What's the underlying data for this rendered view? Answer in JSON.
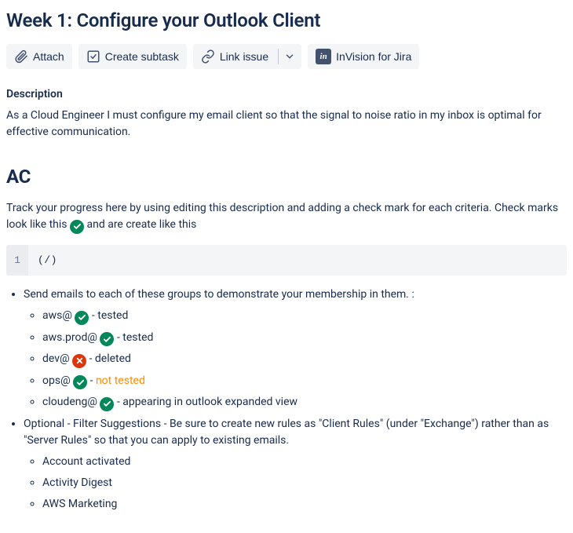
{
  "title": "Week 1: Configure your Outlook Client",
  "toolbar": {
    "attach": "Attach",
    "create_subtask": "Create subtask",
    "link_issue": "Link issue",
    "invision": "InVision for Jira"
  },
  "description": {
    "label": "Description",
    "text": "As a Cloud Engineer I must configure my email client so that the signal to noise ratio in my inbox is optimal for effective communication."
  },
  "ac": {
    "heading": "AC",
    "intro_pre": "Track your progress here by using editing this description and adding a check mark for each criteria. Check marks look like this ",
    "intro_post": " and are create like this",
    "code_line_no": "1",
    "code_text": "(/)",
    "items": {
      "send_header": "Send emails to each of these groups to demonstrate your membership in them. :",
      "aws_prefix": "aws@ ",
      "aws_status": " - tested",
      "awsprod_prefix": "aws.prod@ ",
      "awsprod_status": " - tested",
      "dev_prefix": "dev@ ",
      "dev_status": " - deleted",
      "ops_prefix": "ops@ ",
      "ops_status_dash": " - ",
      "ops_status_text": "not tested",
      "cloudeng_prefix": "cloudeng@ ",
      "cloudeng_status": " - appearing in outlook expanded view",
      "optional_header": "Optional - Filter Suggestions - Be sure to create new rules as \"Client Rules\" (under \"Exchange\") rather than as \"Server Rules\" so that you can apply to existing emails.",
      "opt1": "Account activated",
      "opt2": "Activity Digest",
      "opt3": "AWS Marketing"
    }
  }
}
